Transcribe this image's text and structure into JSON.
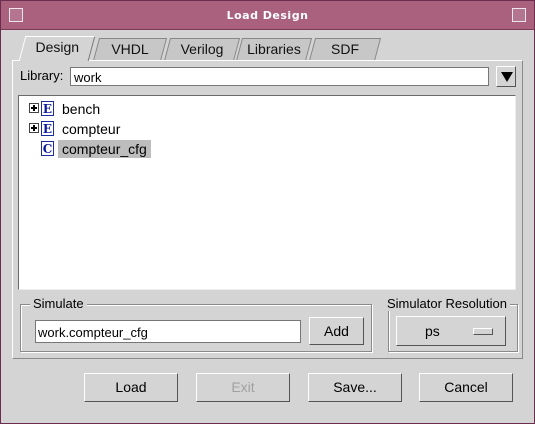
{
  "window": {
    "title": "Load Design"
  },
  "tabs": [
    {
      "label": "Design",
      "active": true
    },
    {
      "label": "VHDL",
      "active": false
    },
    {
      "label": "Verilog",
      "active": false
    },
    {
      "label": "Libraries",
      "active": false
    },
    {
      "label": "SDF",
      "active": false
    }
  ],
  "library": {
    "label": "Library:",
    "value": "work"
  },
  "tree": {
    "items": [
      {
        "label": "bench",
        "badge": "E",
        "expandable": true,
        "selected": false
      },
      {
        "label": "compteur",
        "badge": "E",
        "expandable": true,
        "selected": false
      },
      {
        "label": "compteur_cfg",
        "badge": "C",
        "expandable": false,
        "selected": true
      }
    ]
  },
  "simulate": {
    "group_label": "Simulate",
    "value": "work.compteur_cfg",
    "add_label": "Add"
  },
  "resolution": {
    "group_label": "Simulator Resolution",
    "value": "ps"
  },
  "buttons": {
    "load": "Load",
    "exit": "Exit",
    "save": "Save...",
    "cancel": "Cancel"
  },
  "colors": {
    "titlebar": "#a9617e",
    "window_bg": "#d4d4d4",
    "selection": "#bdbdbd",
    "icon_blue": "#0b1a9a"
  }
}
